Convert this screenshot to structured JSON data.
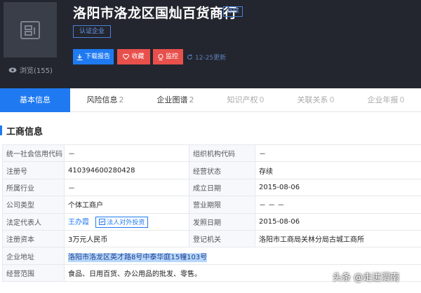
{
  "header": {
    "company_name": "洛阳市洛龙区国灿百货商行",
    "status_tag": "存续",
    "certify_label": "认证企业",
    "views_label": "浏览(155)",
    "buttons": {
      "download": "下载报告",
      "collect": "收藏",
      "monitor": "监控"
    },
    "update_text": "12-25更新"
  },
  "tabs": [
    {
      "label": "基本信息",
      "count": ""
    },
    {
      "label": "风险信息",
      "count": "2"
    },
    {
      "label": "企业图谱",
      "count": "2"
    },
    {
      "label": "知识产权",
      "count": "0"
    },
    {
      "label": "关联关系",
      "count": "0"
    },
    {
      "label": "企业年报",
      "count": "0"
    }
  ],
  "section": {
    "title": "工商信息"
  },
  "info": {
    "row1": {
      "l1": "统一社会信用代码",
      "v1": "－",
      "l2": "组织机构代码",
      "v2": "－"
    },
    "row2": {
      "l1": "注册号",
      "v1": "410394600280428",
      "l2": "经营状态",
      "v2": "存续"
    },
    "row3": {
      "l1": "所属行业",
      "v1": "－",
      "l2": "成立日期",
      "v2": "2015-08-06"
    },
    "row4": {
      "l1": "公司类型",
      "v1": "个体工商户",
      "l2": "营业期限",
      "v2": "－ － －"
    },
    "row5": {
      "l1": "法定代表人",
      "v1": "王办霞",
      "invest": "法人对外投资",
      "l2": "发照日期",
      "v2": "2015-08-06"
    },
    "row6": {
      "l1": "注册资本",
      "v1": "3万元人民币",
      "l2": "登记机关",
      "v2": "洛阳市工商局关林分局古城工商所"
    },
    "row7": {
      "l1": "企业地址",
      "v1": "洛阳市洛龙区英才路8号中泰华庭15幢103号"
    },
    "row8": {
      "l1": "经营范围",
      "v1": "食品、日用百货、办公用品的批发、零售。"
    }
  },
  "watermark": "头条 @走进渭南",
  "colors": {
    "header_bg": "#23262f",
    "accent": "#1f7af1",
    "danger": "#e8504c"
  }
}
